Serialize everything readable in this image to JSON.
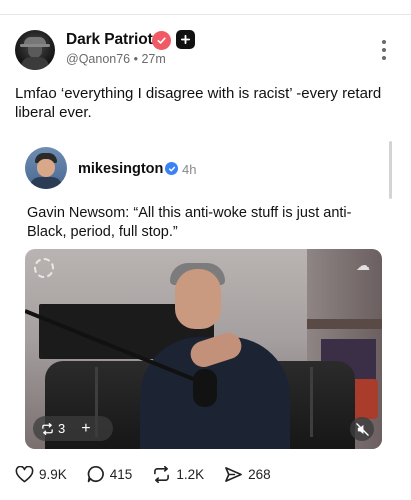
{
  "post": {
    "author_name": "Dark Patriot",
    "handle": "@Qanon76 • 27m",
    "text": "Lmfao ‘everything I disagree with is racist’ -every retard liberal ever."
  },
  "quote": {
    "author_name": "mikesington",
    "time": "4h",
    "text": "Gavin Newsom: “All this anti-woke stuff is just anti-Black, period, full stop.”",
    "video": {
      "repost_count": "3",
      "plus_symbol": "+"
    }
  },
  "actions": {
    "likes": "9.9K",
    "replies": "415",
    "reposts": "1.2K",
    "shares": "268"
  },
  "colors": {
    "verified_badge_post": "#f05a64",
    "verified_badge_quote": "#3b82f6",
    "text_primary": "#111111",
    "text_secondary": "#6a6a6a"
  },
  "icons": [
    "verified-icon",
    "plus-icon",
    "more-icon",
    "repost-icon",
    "mute-icon",
    "heart-icon",
    "comment-icon",
    "share-icon"
  ]
}
